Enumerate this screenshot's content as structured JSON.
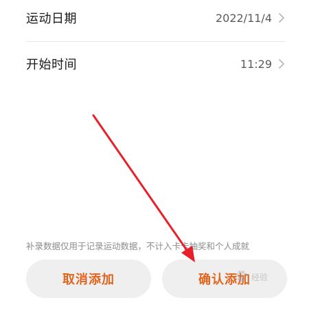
{
  "form": {
    "date": {
      "label": "运动日期",
      "value": "2022/11/4",
      "icon": "chevron-right-icon"
    },
    "start_time": {
      "label": "开始时间",
      "value": "11:29",
      "icon": "chevron-right-icon"
    }
  },
  "note": "补录数据仅用于记录运动数据，不计入卡卡抽奖和个人成就",
  "buttons": {
    "cancel_label": "取消添加",
    "confirm_label": "确认添加"
  },
  "colors": {
    "accent": "#e0641e",
    "button_bg": "#efefef",
    "annotation_arrow": "#e8202a"
  },
  "watermark": {
    "icon": "paw-icon",
    "text": "经验"
  }
}
